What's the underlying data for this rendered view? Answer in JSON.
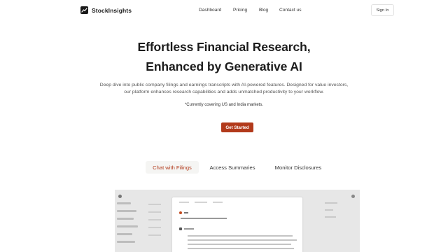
{
  "header": {
    "brand_name": "StockInsights",
    "nav": [
      "Dashboard",
      "Pricing",
      "Blog",
      "Contact us"
    ],
    "signin_label": "Sign In"
  },
  "hero": {
    "title_line1": "Effortless Financial Research,",
    "title_line2": "Enhanced by Generative AI",
    "description": "Deep dive into public company filings and earnings transcripts with AI-powered features. Designed for value investors, our platform enhances research capabilities and adds unmatched productivity to your workflow.",
    "coverage_note": "*Currently covering US and India markets.",
    "cta_label": "Get Started"
  },
  "tabs": [
    {
      "label": "Chat with Filings",
      "active": true
    },
    {
      "label": "Access Summaries",
      "active": false
    },
    {
      "label": "Monitor Disclosures",
      "active": false
    }
  ],
  "colors": {
    "accent": "#b23a1b",
    "preview_bg": "#e7e7e7"
  },
  "icons": {
    "brand_logo": "chart-line-icon"
  }
}
